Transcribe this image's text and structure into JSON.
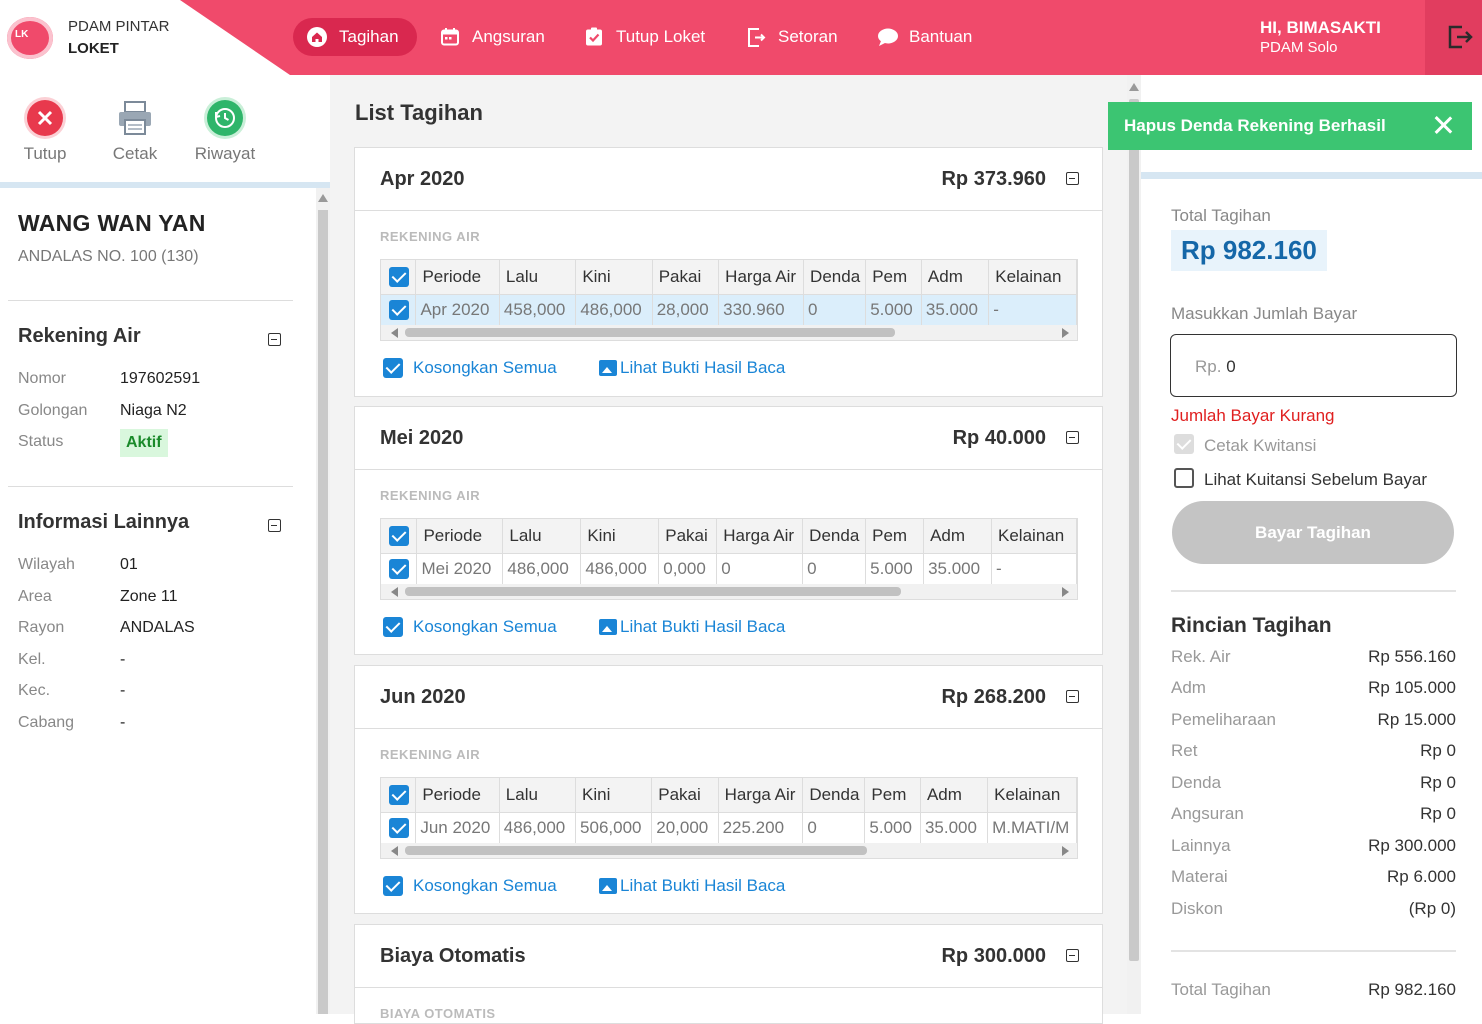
{
  "app": {
    "brand_line1": "PDAM PINTAR",
    "brand_line2": "LOKET",
    "logo_text": "LK"
  },
  "nav": [
    {
      "label": "Tagihan",
      "icon": "home-icon",
      "active": true
    },
    {
      "label": "Angsuran",
      "icon": "calendar-icon"
    },
    {
      "label": "Tutup Loket",
      "icon": "clipboard-check-icon"
    },
    {
      "label": "Setoran",
      "icon": "document-export-icon"
    },
    {
      "label": "Bantuan",
      "icon": "chat-bubble-icon"
    }
  ],
  "user": {
    "greeting": "HI, BIMASAKTI",
    "org": "PDAM Solo"
  },
  "toolbar": {
    "close": "Tutup",
    "print": "Cetak",
    "history": "Riwayat"
  },
  "customer": {
    "name": "WANG WAN YAN",
    "address": "ANDALAS NO.  100 (130)"
  },
  "rekening_air": {
    "title": "Rekening Air",
    "rows": [
      {
        "label": "Nomor",
        "value": "197602591"
      },
      {
        "label": "Golongan",
        "value": "Niaga N2"
      },
      {
        "label": "Status",
        "value": "Aktif"
      }
    ]
  },
  "info": {
    "title": "Informasi Lainnya",
    "rows": [
      {
        "label": "Wilayah",
        "value": "01"
      },
      {
        "label": "Area",
        "value": "Zone 11"
      },
      {
        "label": "Rayon",
        "value": "ANDALAS"
      },
      {
        "label": "Kel.",
        "value": "-"
      },
      {
        "label": "Kec.",
        "value": "-"
      },
      {
        "label": "Cabang",
        "value": "-"
      }
    ]
  },
  "list": {
    "title": "List Tagihan",
    "sub_label": "REKENING AIR",
    "headers": [
      "Periode",
      "Lalu",
      "Kini",
      "Pakai",
      "Harga Air",
      "Denda",
      "Pem",
      "Adm",
      "Kelainan"
    ],
    "clear_all": "Kosongkan Semua",
    "view_proof": "Lihat Bukti Hasil Baca",
    "cards": [
      {
        "title": "Apr 2020",
        "amount": "Rp 373.960",
        "row": [
          "Apr 2020",
          "458,000",
          "486,000",
          "28,000",
          "330.960",
          "0",
          "5.000",
          "35.000",
          "-"
        ]
      },
      {
        "title": "Mei 2020",
        "amount": "Rp 40.000",
        "row": [
          "Mei 2020",
          "486,000",
          "486,000",
          "0,000",
          "0",
          "0",
          "5.000",
          "35.000",
          "-"
        ]
      },
      {
        "title": "Jun 2020",
        "amount": "Rp 268.200",
        "row": [
          "Jun 2020",
          "486,000",
          "506,000",
          "20,000",
          "225.200",
          "0",
          "5.000",
          "35.000",
          "M.MATI/M"
        ]
      }
    ],
    "auto": {
      "title": "Biaya Otomatis",
      "amount": "Rp 300.000",
      "sub_label": "BIAYA OTOMATIS"
    }
  },
  "toast": {
    "message": "Hapus Denda Rekening Berhasil"
  },
  "payment": {
    "total_label": "Total Tagihan",
    "total_value": "Rp 982.160",
    "input_label": "Masukkan Jumlah Bayar",
    "input_prefix": "Rp.",
    "input_value": "0",
    "warning": "Jumlah Bayar Kurang",
    "print_receipt": "Cetak Kwitansi",
    "preview_receipt": "Lihat Kuitansi Sebelum Bayar",
    "pay_button": "Bayar Tagihan"
  },
  "details": {
    "title": "Rincian Tagihan",
    "rows": [
      {
        "label": "Rek. Air",
        "value": "Rp 556.160"
      },
      {
        "label": "Adm",
        "value": "Rp 105.000"
      },
      {
        "label": "Pemeliharaan",
        "value": "Rp 15.000"
      },
      {
        "label": "Ret",
        "value": "Rp 0"
      },
      {
        "label": "Denda",
        "value": "Rp 0"
      },
      {
        "label": "Angsuran",
        "value": "Rp 0"
      },
      {
        "label": "Lainnya",
        "value": "Rp 300.000"
      },
      {
        "label": "Materai",
        "value": "Rp 6.000"
      },
      {
        "label": "Diskon",
        "value": "(Rp 0)"
      }
    ],
    "total_label": "Total Tagihan",
    "total_value": "Rp 982.160"
  },
  "colors": {
    "primary": "#f04a6b",
    "accent": "#1a85d6",
    "success": "#3cc572",
    "danger": "#e01f1f"
  }
}
